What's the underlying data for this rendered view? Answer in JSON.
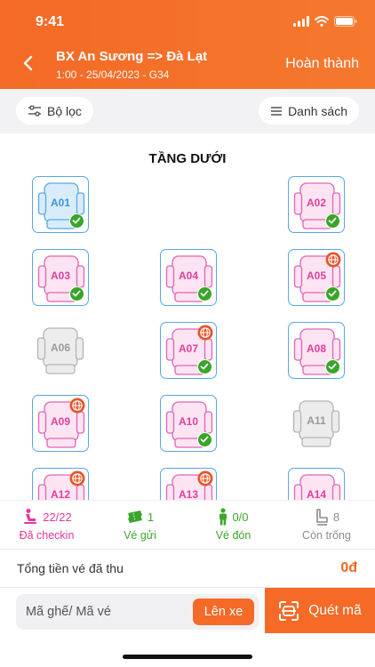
{
  "status": {
    "time": "9:41"
  },
  "header": {
    "route": "BX An Sương => Đà Lạt",
    "trip": "1:00 - 25/04/2023 - G34",
    "done_label": "Hoàn thành"
  },
  "toolbar": {
    "filter_label": "Bộ lọc",
    "list_label": "Danh sách"
  },
  "floor": {
    "title": "TẦNG DƯỚI"
  },
  "colors": {
    "accent": "#f46a26",
    "booked": "#e264b4",
    "selected": "#5aa7e6",
    "empty": "#b4b4b4",
    "check": "#37a526",
    "online": "#e8542a"
  },
  "seats": [
    {
      "label": "A01",
      "state": "selected",
      "checked": true,
      "online": false
    },
    {
      "label": "A02",
      "state": "booked",
      "checked": true,
      "online": false
    },
    {
      "label": "A03",
      "state": "booked",
      "checked": true,
      "online": false
    },
    {
      "label": "A04",
      "state": "booked",
      "checked": true,
      "online": false
    },
    {
      "label": "A05",
      "state": "booked",
      "checked": true,
      "online": true
    },
    {
      "label": "A06",
      "state": "empty",
      "checked": false,
      "online": false
    },
    {
      "label": "A07",
      "state": "booked",
      "checked": true,
      "online": true
    },
    {
      "label": "A08",
      "state": "booked",
      "checked": true,
      "online": false
    },
    {
      "label": "A09",
      "state": "booked",
      "checked": false,
      "online": true
    },
    {
      "label": "A10",
      "state": "booked",
      "checked": true,
      "online": false
    },
    {
      "label": "A11",
      "state": "empty",
      "checked": false,
      "online": false
    },
    {
      "label": "A12",
      "state": "booked",
      "checked": false,
      "online": true
    },
    {
      "label": "A13",
      "state": "booked",
      "checked": false,
      "online": true
    },
    {
      "label": "A14",
      "state": "booked",
      "checked": false,
      "online": false
    }
  ],
  "stats": [
    {
      "icon": "checkin-icon",
      "value": "22/22",
      "label": "Đã checkin",
      "color": "#e6389a"
    },
    {
      "icon": "ticket-icon",
      "value": "1",
      "label": "Vé gửi",
      "color": "#3aa72b"
    },
    {
      "icon": "person-icon",
      "value": "0/0",
      "label": "Vé đón",
      "color": "#3aa72b"
    },
    {
      "icon": "seat-icon",
      "value": "8",
      "label": "Còn trống",
      "color": "#8c8c8c"
    }
  ],
  "total": {
    "label": "Tổng tiền vé đã thu",
    "value": "0đ"
  },
  "search": {
    "placeholder": "Mã ghế/ Mã vé",
    "go_label": "Lên xe"
  },
  "scan": {
    "label": "Quét mã"
  }
}
